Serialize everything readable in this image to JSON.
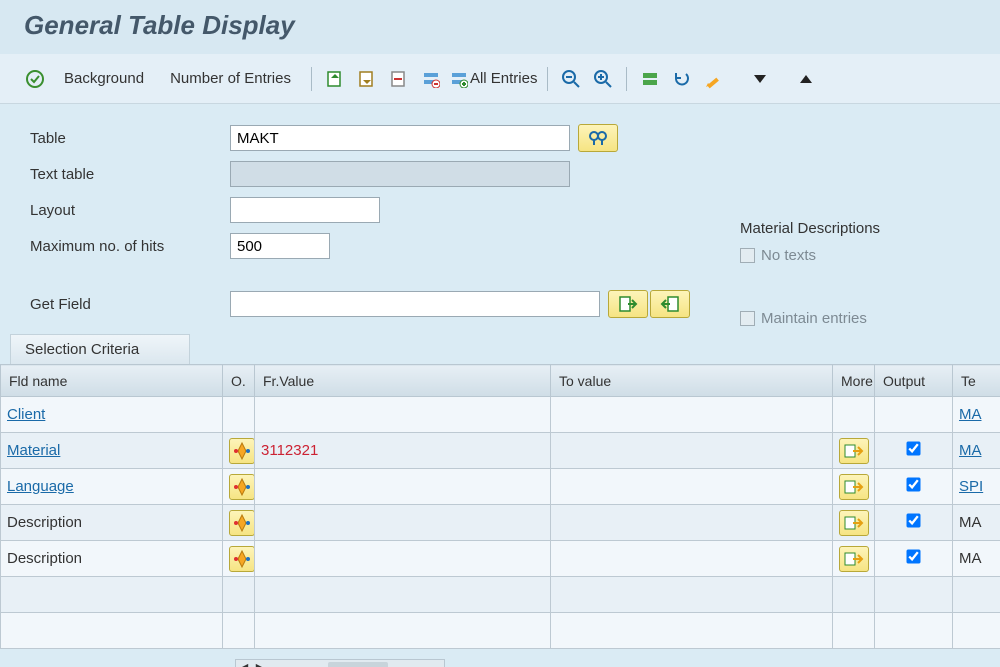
{
  "title": "General Table Display",
  "toolbar": {
    "execute": "",
    "background": "Background",
    "entries": "Number of Entries",
    "all_entries": "All Entries"
  },
  "form": {
    "table_label": "Table",
    "table_value": "MAKT",
    "texttable_label": "Text table",
    "texttable_value": "",
    "layout_label": "Layout",
    "layout_value": "",
    "maxhits_label": "Maximum no. of hits",
    "maxhits_value": "500",
    "getfield_label": "Get Field",
    "getfield_value": ""
  },
  "side": {
    "heading": "Material Descriptions",
    "no_texts": "No texts",
    "maintain": "Maintain entries"
  },
  "group_label": "Selection Criteria",
  "grid_headers": {
    "fld": "Fld name",
    "o": "O.",
    "fr": "Fr.Value",
    "to": "To value",
    "more": "More",
    "out": "Output",
    "te": "Te"
  },
  "grid_rows": [
    {
      "fld": "Client",
      "link": true,
      "o": "",
      "fr": "",
      "to": "",
      "more": false,
      "out": false,
      "te": "MA",
      "telink": true
    },
    {
      "fld": "Material",
      "link": true,
      "o": "op",
      "fr": "3112321",
      "frred": true,
      "to": "",
      "more": true,
      "out": true,
      "te": "MA",
      "telink": true
    },
    {
      "fld": "Language",
      "link": true,
      "o": "op",
      "fr": "",
      "to": "",
      "more": true,
      "out": true,
      "te": "SPI",
      "telink": true
    },
    {
      "fld": "Description",
      "link": false,
      "o": "op",
      "fr": "",
      "to": "",
      "more": true,
      "out": true,
      "te": "MA",
      "telink": false
    },
    {
      "fld": "Description",
      "link": false,
      "o": "op",
      "fr": "",
      "to": "",
      "more": true,
      "out": true,
      "te": "MA",
      "telink": false
    },
    {
      "fld": "",
      "link": false,
      "o": "",
      "fr": "",
      "to": "",
      "more": false,
      "out": false,
      "te": "",
      "blank": true
    },
    {
      "fld": "",
      "link": false,
      "o": "",
      "fr": "",
      "to": "",
      "more": false,
      "out": false,
      "te": "",
      "blank": true
    }
  ]
}
